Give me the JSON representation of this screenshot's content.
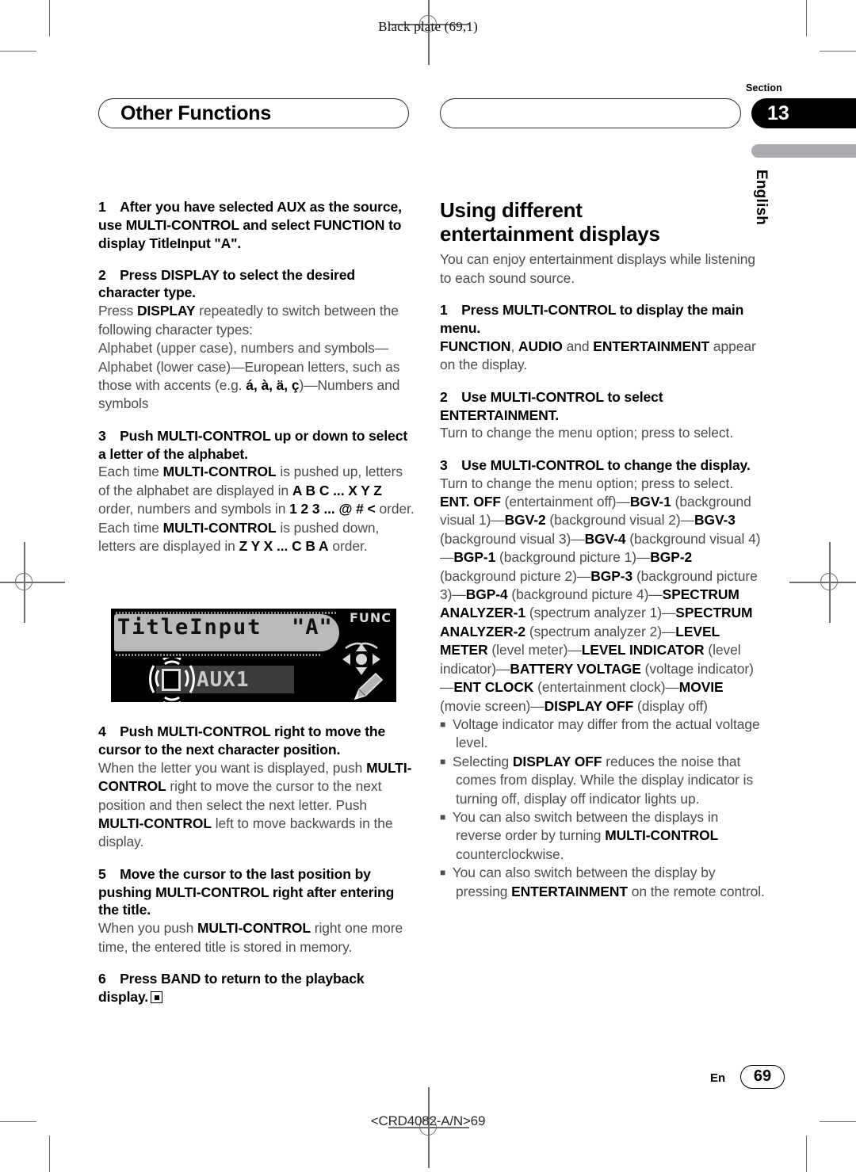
{
  "header": {
    "plate": "Black plate (69,1)",
    "chapter_title": "Other Functions",
    "section_label": "Section",
    "section_number": "13",
    "language": "English"
  },
  "left_column": {
    "step1": "1 After you have selected AUX as the source, use MULTI-CONTROL and select FUNCTION to display TitleInput  \"A\".",
    "step2_title": "2 Press DISPLAY to select the desired character type.",
    "step2_body_a": "Press ",
    "step2_body_b": "DISPLAY",
    "step2_body_c": " repeatedly to switch between the following character types:",
    "step2_body_d": "Alphabet (upper case), numbers and symbols—Alphabet (lower case)—European letters, such as those with accents (e.g. ",
    "step2_body_e": "á, à, ä, ç",
    "step2_body_f": ")—Numbers and symbols",
    "step3_title": "3 Push MULTI-CONTROL up or down to select a letter of the alphabet.",
    "step3_b1": "Each time ",
    "step3_b2": "MULTI-CONTROL",
    "step3_b3": " is pushed up, letters of the alphabet are displayed in ",
    "step3_b4": "A B C ... X Y Z",
    "step3_b5": " order, numbers and symbols in ",
    "step3_b6": "1 2 3 ... @ # <",
    "step3_b7": " order. Each time ",
    "step3_b8": "MULTI-CONTROL",
    "step3_b9": " is pushed down, letters are displayed in ",
    "step3_b10": "Z Y X ... C B A",
    "step3_b11": " order.",
    "step4_title": "4 Push MULTI-CONTROL right to move the cursor to the next character position.",
    "step4_b1": "When the letter you want is displayed, push ",
    "step4_b2": "MULTI-CONTROL",
    "step4_b3": " right to move the cursor to the next position and then select the next letter. Push ",
    "step4_b4": "MULTI-CONTROL",
    "step4_b5": " left to move backwards in the display.",
    "step5_title": "5 Move the cursor to the last position by pushing MULTI-CONTROL right after entering the title.",
    "step5_b1": "When you push ",
    "step5_b2": "MULTI-CONTROL",
    "step5_b3": " right one more time, the entered title is stored in memory.",
    "step6_title": "6 Press BAND to return to the playback display."
  },
  "figure": {
    "title_text": "TitleInput",
    "quote_text": "\"A\"",
    "source_text": "AUX1",
    "func_label": "FUNC"
  },
  "right_column": {
    "heading_line1": "Using different",
    "heading_line2": "entertainment displays",
    "intro": "You can enjoy entertainment displays while listening to each sound source.",
    "step1_title": "1 Press MULTI-CONTROL to display the main menu.",
    "step1_b1": "FUNCTION",
    "step1_b2": ", ",
    "step1_b3": "AUDIO",
    "step1_b4": " and ",
    "step1_b5": "ENTERTAINMENT",
    "step1_b6": " appear on the display.",
    "step2_title": "2 Use MULTI-CONTROL to select ENTERTAINMENT.",
    "step2_body": "Turn to change the menu option; press to select.",
    "step3_title": "3 Use MULTI-CONTROL to change the display.",
    "step3_body": "Turn to change the menu option; press to select.",
    "display_list": [
      {
        "bold": "ENT. OFF",
        "plain": " (entertainment off)—"
      },
      {
        "bold": "BGV-1",
        "plain": " (background visual 1)—"
      },
      {
        "bold": "BGV-2",
        "plain": " (background visual 2)—"
      },
      {
        "bold": "BGV-3",
        "plain": " (background visual 3)—"
      },
      {
        "bold": "BGV-4",
        "plain": " (background visual 4)—"
      },
      {
        "bold": "BGP-1",
        "plain": " (background picture 1)—"
      },
      {
        "bold": "BGP-2",
        "plain": " (background picture 2)—"
      },
      {
        "bold": "BGP-3",
        "plain": " (background picture 3)—"
      },
      {
        "bold": "BGP-4",
        "plain": " (background picture 4)—"
      },
      {
        "bold": "SPECTRUM ANALYZER-1",
        "plain": " (spectrum analyzer 1)—"
      },
      {
        "bold": "SPECTRUM ANALYZER-2",
        "plain": " (spectrum analyzer 2)—"
      },
      {
        "bold": "LEVEL METER",
        "plain": " (level meter)—"
      },
      {
        "bold": "LEVEL INDICATOR",
        "plain": " (level indicator)—"
      },
      {
        "bold": "BATTERY VOLTAGE",
        "plain": " (voltage indicator)—"
      },
      {
        "bold": "ENT CLOCK",
        "plain": " (entertainment clock)—"
      },
      {
        "bold": "MOVIE",
        "plain": " (movie screen)—"
      },
      {
        "bold": "DISPLAY OFF",
        "plain": " (display off)"
      }
    ],
    "note1": "Voltage indicator may differ from the actual voltage level.",
    "note2_a": "Selecting ",
    "note2_b": "DISPLAY OFF",
    "note2_c": " reduces the noise that comes from display. While the display indicator is turning off, display off indicator lights up.",
    "note3_a": "You can also switch between the displays in reverse order by turning ",
    "note3_b": "MULTI-CONTROL",
    "note3_c": " counterclockwise.",
    "note4_a": "You can also switch between the display by pressing ",
    "note4_b": "ENTERTAINMENT",
    "note4_c": " on the remote control."
  },
  "footer": {
    "lang_code": "En",
    "page_number": "69",
    "doc_code": "<CRD4082-A/N>69"
  }
}
